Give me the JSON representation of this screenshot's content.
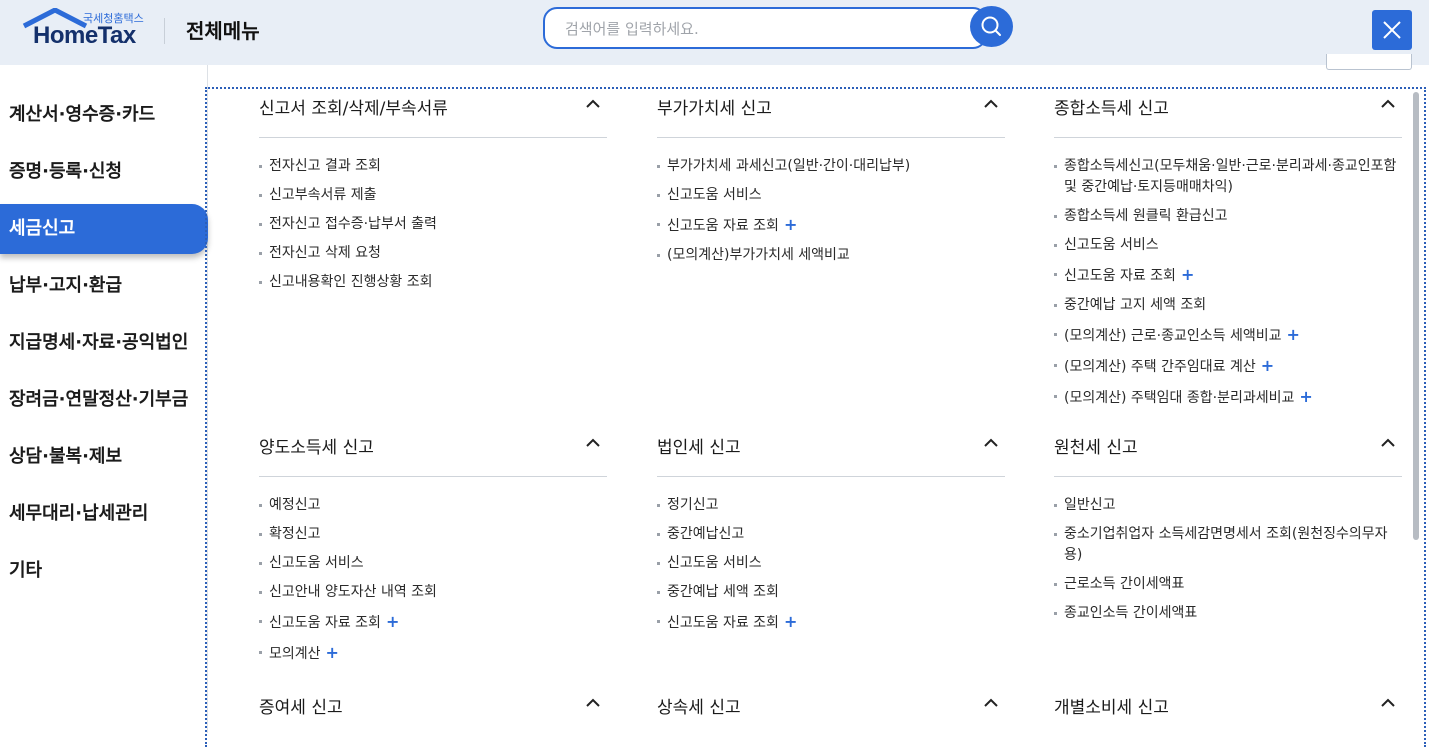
{
  "header": {
    "logo_small": "국세청홈택스",
    "logo_main": "HomeTax",
    "title": "전체메뉴",
    "search_placeholder": "검색어를 입력하세요."
  },
  "sidebar": {
    "items": [
      {
        "label": "계산서·영수증·카드",
        "active": false
      },
      {
        "label": "증명·등록·신청",
        "active": false
      },
      {
        "label": "세금신고",
        "active": true
      },
      {
        "label": "납부·고지·환급",
        "active": false
      },
      {
        "label": "지급명세·자료·공익법인",
        "active": false
      },
      {
        "label": "장려금·연말정산·기부금",
        "active": false
      },
      {
        "label": "상담·불복·제보",
        "active": false
      },
      {
        "label": "세무대리·납세관리",
        "active": false
      },
      {
        "label": "기타",
        "active": false
      }
    ]
  },
  "sections": [
    {
      "title": "신고서 조회/삭제/부속서류",
      "items": [
        {
          "label": "전자신고 결과 조회",
          "plus": false
        },
        {
          "label": "신고부속서류 제출",
          "plus": false
        },
        {
          "label": "전자신고 접수증·납부서 출력",
          "plus": false
        },
        {
          "label": "전자신고 삭제 요청",
          "plus": false
        },
        {
          "label": "신고내용확인 진행상황 조회",
          "plus": false
        }
      ]
    },
    {
      "title": "부가가치세 신고",
      "items": [
        {
          "label": "부가가치세 과세신고(일반·간이·대리납부)",
          "plus": false
        },
        {
          "label": "신고도움 서비스",
          "plus": false
        },
        {
          "label": "신고도움 자료 조회",
          "plus": true
        },
        {
          "label": "(모의계산)부가가치세 세액비교",
          "plus": false
        }
      ]
    },
    {
      "title": "종합소득세 신고",
      "items": [
        {
          "label": "종합소득세신고(모두채움·일반·근로·분리과세·종교인포함 및 중간예납·토지등매매차익)",
          "plus": false
        },
        {
          "label": "종합소득세 원클릭 환급신고",
          "plus": false
        },
        {
          "label": "신고도움 서비스",
          "plus": false
        },
        {
          "label": "신고도움 자료 조회",
          "plus": true
        },
        {
          "label": "중간예납 고지 세액 조회",
          "plus": false
        },
        {
          "label": "(모의계산) 근로·종교인소득 세액비교",
          "plus": true
        },
        {
          "label": "(모의계산) 주택 간주임대료 계산",
          "plus": true
        },
        {
          "label": "(모의계산) 주택임대 종합·분리과세비교",
          "plus": true
        }
      ]
    },
    {
      "title": "양도소득세 신고",
      "items": [
        {
          "label": "예정신고",
          "plus": false
        },
        {
          "label": "확정신고",
          "plus": false
        },
        {
          "label": "신고도움 서비스",
          "plus": false
        },
        {
          "label": "신고안내 양도자산 내역 조회",
          "plus": false
        },
        {
          "label": "신고도움 자료 조회",
          "plus": true
        },
        {
          "label": "모의계산",
          "plus": true
        }
      ]
    },
    {
      "title": "법인세 신고",
      "items": [
        {
          "label": "정기신고",
          "plus": false
        },
        {
          "label": "중간예납신고",
          "plus": false
        },
        {
          "label": "신고도움 서비스",
          "plus": false
        },
        {
          "label": "중간예납 세액 조회",
          "plus": false
        },
        {
          "label": "신고도움 자료 조회",
          "plus": true
        }
      ]
    },
    {
      "title": "원천세 신고",
      "items": [
        {
          "label": "일반신고",
          "plus": false
        },
        {
          "label": "중소기업취업자 소득세감면명세서 조회(원천징수의무자용)",
          "plus": false
        },
        {
          "label": "근로소득 간이세액표",
          "plus": false
        },
        {
          "label": "종교인소득 간이세액표",
          "plus": false
        }
      ]
    },
    {
      "title": "증여세 신고",
      "items": []
    },
    {
      "title": "상속세 신고",
      "items": []
    },
    {
      "title": "개별소비세 신고",
      "items": []
    }
  ]
}
